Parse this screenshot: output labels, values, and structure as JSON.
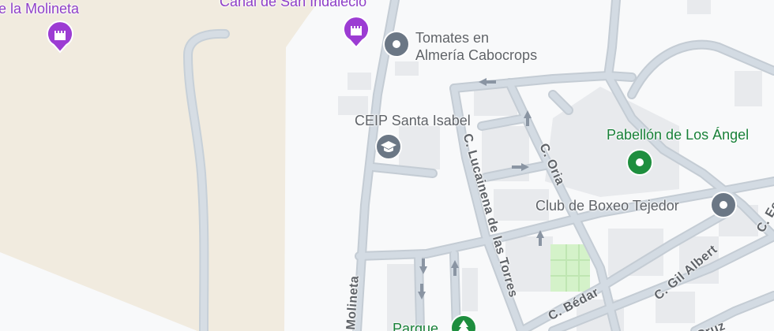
{
  "colors": {
    "background": "#f8f9fa",
    "sand": "#f1ebdf",
    "road": "#d3dbe3",
    "road_outline": "#c4ccd4",
    "park": "#d4f2c9",
    "building": "#e8eaed",
    "poi_gray": "#6b7785",
    "poi_purple": "#9c3cd3",
    "poi_green": "#1e8e3e",
    "arrow": "#8a95a3"
  },
  "pois": {
    "molineta_partial": {
      "label": "e la Molineta",
      "icon": "castle-icon"
    },
    "canal": {
      "label": "Canal de San Indalecio",
      "icon": "castle-icon"
    },
    "tomates": {
      "label_line1": "Tomates en",
      "label_line2": "Almería Cabocrops",
      "icon": "location-dot-icon"
    },
    "ceip": {
      "label": "CEIP Santa Isabel",
      "icon": "school-cap-icon"
    },
    "pabellon": {
      "label": "Pabellón de Los Ángel",
      "icon": "location-dot-icon"
    },
    "boxeo": {
      "label": "Club de Boxeo Tejedor",
      "icon": "location-dot-icon"
    },
    "parque": {
      "label": "Parque",
      "icon": "tree-icon"
    }
  },
  "streets": {
    "molineta": "Molineta",
    "lucainena": "C. Lucainena de las Torres",
    "oria": "C. Oria",
    "bedar": "C. Bédar",
    "gil_albert": "C. Gil Albert",
    "cruz": "Cruz",
    "ec_partial": "C. Ec"
  }
}
